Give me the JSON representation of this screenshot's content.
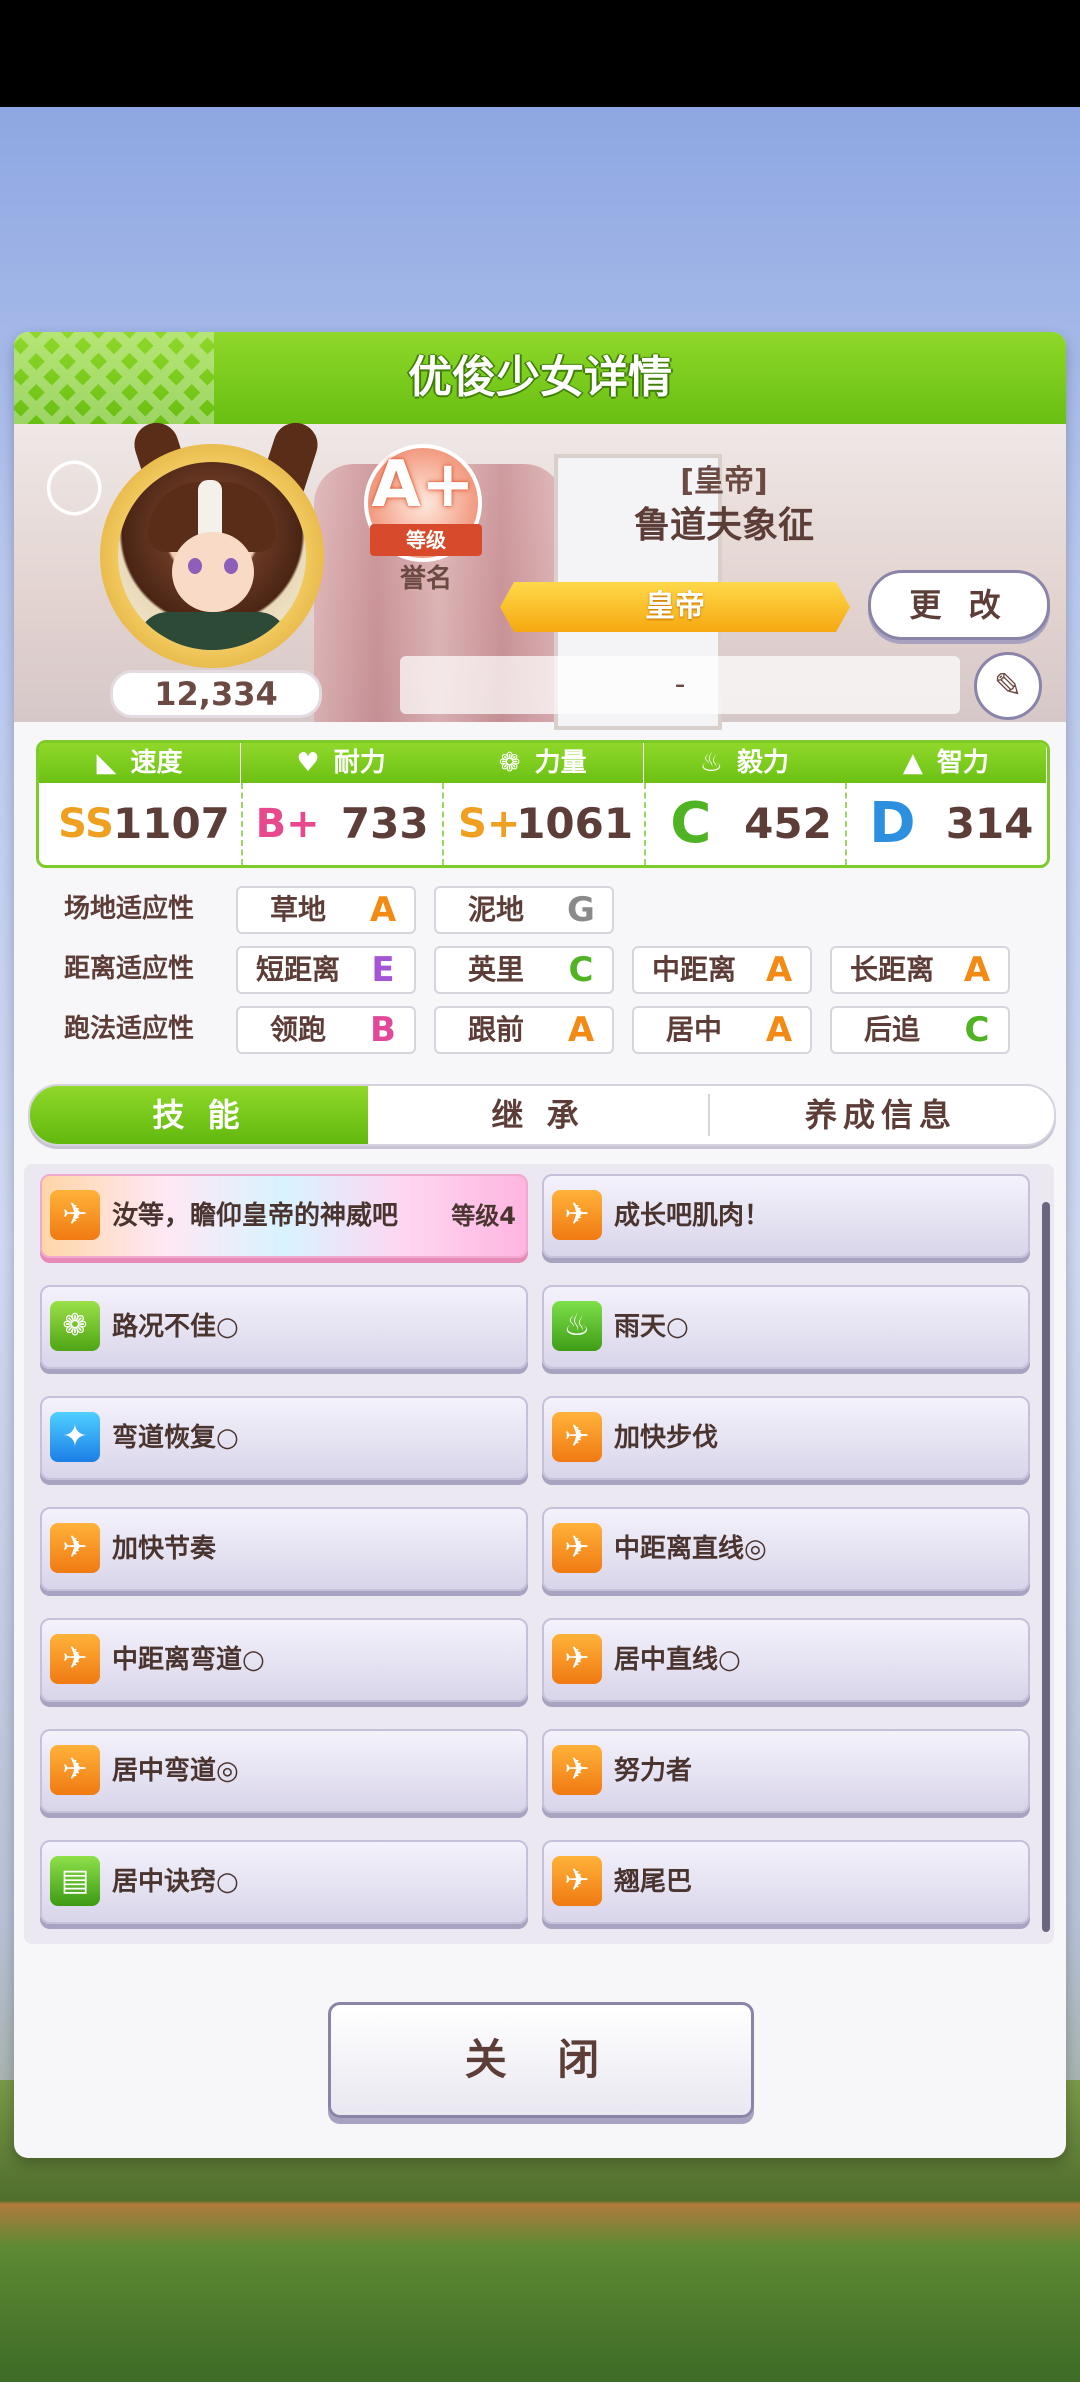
{
  "header": {
    "title": "优俊少女详情"
  },
  "profile": {
    "fans": "12,334",
    "rank": "A+",
    "rank_ribbon": "等级",
    "rank_sub": "誉名",
    "title_tag": "[皇帝]",
    "name": "鲁道夫象征",
    "title_banner": "皇帝",
    "change_label": "更 改",
    "memo": "-"
  },
  "stats": [
    {
      "label": "速度",
      "icon": "shoe-icon",
      "grade": "SS",
      "value": "1107",
      "color": "#f0a020"
    },
    {
      "label": "耐力",
      "icon": "heart-icon",
      "grade": "B+",
      "value": "733",
      "color": "#e8488c"
    },
    {
      "label": "力量",
      "icon": "arm-icon",
      "grade": "S+",
      "value": "1061",
      "color": "#f0a020"
    },
    {
      "label": "毅力",
      "icon": "flame-icon",
      "grade": "C",
      "value": "452",
      "color": "#4fb324"
    },
    {
      "label": "智力",
      "icon": "mortarboard-icon",
      "grade": "D",
      "value": "314",
      "color": "#2d8fe0"
    }
  ],
  "aptitudes": {
    "track": {
      "label": "场地适应性",
      "items": [
        {
          "name": "草地",
          "grade": "A"
        },
        {
          "name": "泥地",
          "grade": "G"
        }
      ]
    },
    "distance": {
      "label": "距离适应性",
      "items": [
        {
          "name": "短距离",
          "grade": "E"
        },
        {
          "name": "英里",
          "grade": "C"
        },
        {
          "name": "中距离",
          "grade": "A"
        },
        {
          "name": "长距离",
          "grade": "A"
        }
      ]
    },
    "style": {
      "label": "跑法适应性",
      "items": [
        {
          "name": "领跑",
          "grade": "B"
        },
        {
          "name": "跟前",
          "grade": "A"
        },
        {
          "name": "居中",
          "grade": "A"
        },
        {
          "name": "后追",
          "grade": "C"
        }
      ]
    }
  },
  "grade_colors": {
    "A": "#f28a14",
    "B": "#e2489a",
    "C": "#4fb324",
    "E": "#a455d6",
    "G": "#8a8a8a"
  },
  "tabs": [
    {
      "label": "技 能",
      "active": true
    },
    {
      "label": "继 承",
      "active": false
    },
    {
      "label": "养成信息",
      "active": false
    }
  ],
  "skills": [
    {
      "name": "汝等，瞻仰皇帝的神威吧",
      "level": "等级4",
      "icon": "speed-icon",
      "rare": true
    },
    {
      "name": "成长吧肌肉！",
      "icon": "speed-icon"
    },
    {
      "name": "路况不佳○",
      "icon": "power-icon"
    },
    {
      "name": "雨天○",
      "icon": "fire-icon"
    },
    {
      "name": "弯道恢复○",
      "icon": "heal-icon"
    },
    {
      "name": "加快步伐",
      "icon": "speed-icon"
    },
    {
      "name": "加快节奏",
      "icon": "speed-icon"
    },
    {
      "name": "中距离直线◎",
      "icon": "speed-icon"
    },
    {
      "name": "中距离弯道○",
      "icon": "speed-icon"
    },
    {
      "name": "居中直线○",
      "icon": "speed-icon"
    },
    {
      "name": "居中弯道◎",
      "icon": "speed-icon"
    },
    {
      "name": "努力者",
      "icon": "speed-icon"
    },
    {
      "name": "居中诀窍○",
      "icon": "book-icon"
    },
    {
      "name": "翘尾巴",
      "icon": "speed-icon"
    }
  ],
  "close_label": "关 闭"
}
